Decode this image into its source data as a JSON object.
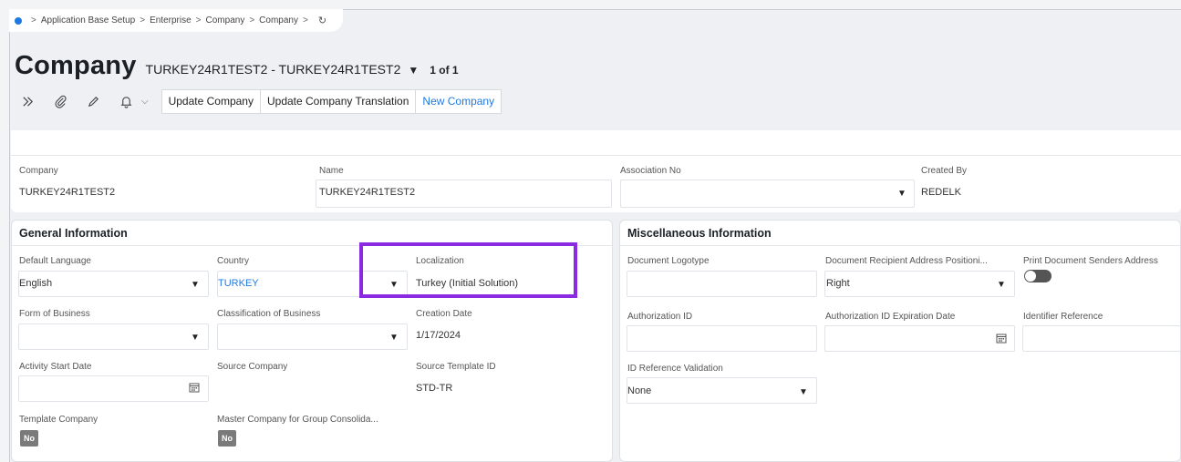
{
  "breadcrumb": {
    "items": [
      "Application Base Setup",
      "Enterprise",
      "Company",
      "Company"
    ],
    "separator": ">",
    "refresh_icon": "refresh-icon"
  },
  "header": {
    "title": "Company",
    "record": "TURKEY24R1TEST2 - TURKEY24R1TEST2",
    "record_caret": "▼",
    "count": "1 of 1"
  },
  "toolbar": {
    "icons": [
      "expand-icon",
      "attachment-icon",
      "edit-icon",
      "notification-bell-icon",
      "chevron-down-icon"
    ],
    "buttons": [
      "Update Company",
      "Update Company Translation",
      "New Company"
    ]
  },
  "top_fields": {
    "company_label": "Company",
    "company_value": "TURKEY24R1TEST2",
    "name_label": "Name",
    "name_value": "TURKEY24R1TEST2",
    "association_label": "Association No",
    "association_value": "",
    "created_by_label": "Created By",
    "created_by_value": "REDELK"
  },
  "general": {
    "title": "General Information",
    "default_language_label": "Default Language",
    "default_language_value": "English",
    "country_label": "Country",
    "country_value": "TURKEY",
    "localization_label": "Localization",
    "localization_value": "Turkey (Initial Solution)",
    "form_of_business_label": "Form of Business",
    "classification_label": "Classification of Business",
    "creation_date_label": "Creation Date",
    "creation_date_value": "1/17/2024",
    "activity_start_label": "Activity Start Date",
    "source_company_label": "Source Company",
    "source_template_label": "Source Template ID",
    "source_template_value": "STD-TR",
    "template_company_label": "Template Company",
    "template_company_value": "No",
    "master_company_label": "Master Company for Group Consolida...",
    "master_company_value": "No"
  },
  "misc": {
    "title": "Miscellaneous Information",
    "logotype_label": "Document Logotype",
    "recipient_pos_label": "Document Recipient Address Positioni...",
    "recipient_pos_value": "Right",
    "print_senders_label": "Print Document Senders Address",
    "authorization_id_label": "Authorization ID",
    "authorization_exp_label": "Authorization ID Expiration Date",
    "identifier_ref_label": "Identifier Reference",
    "id_ref_validation_label": "ID Reference Validation",
    "id_ref_validation_value": "None"
  },
  "colors": {
    "accent": "#1f7ae0",
    "highlight": "#8a2be2",
    "badge": "#7a7a7a"
  }
}
